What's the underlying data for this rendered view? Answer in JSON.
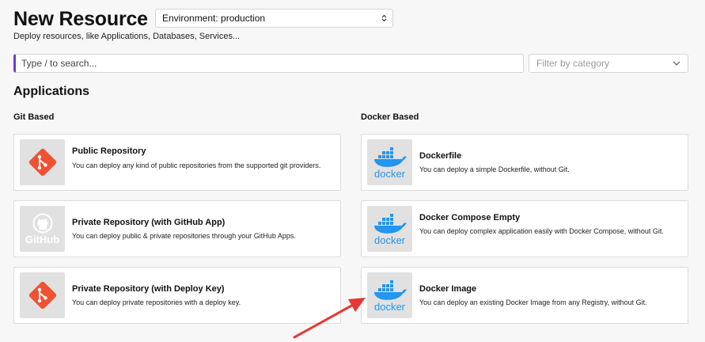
{
  "header": {
    "title": "New Resource",
    "environment_select": "Environment: production",
    "subtitle": "Deploy resources, like Applications, Databases, Services..."
  },
  "search": {
    "placeholder": "Type / to search...",
    "category_placeholder": "Filter by category"
  },
  "sections": {
    "applications": "Applications",
    "git_based": "Git Based",
    "docker_based": "Docker Based"
  },
  "git_cards": [
    {
      "title": "Public Repository",
      "description": "You can deploy any kind of public repositories from the supported git providers.",
      "icon": "git-icon"
    },
    {
      "title": "Private Repository (with GitHub App)",
      "description": "You can deploy public & private repositories through your GitHub Apps.",
      "icon": "github-icon"
    },
    {
      "title": "Private Repository (with Deploy Key)",
      "description": "You can deploy private repositories with a deploy key.",
      "icon": "git-icon"
    }
  ],
  "docker_cards": [
    {
      "title": "Dockerfile",
      "description": "You can deploy a simple Dockerfile, without Git.",
      "icon": "docker-icon"
    },
    {
      "title": "Docker Compose Empty",
      "description": "You can deploy complex application easily with Docker Compose, without Git.",
      "icon": "docker-icon"
    },
    {
      "title": "Docker Image",
      "description": "You can deploy an existing Docker Image from any Registry, without Git.",
      "icon": "docker-icon"
    }
  ],
  "icon_labels": {
    "github": "GitHub",
    "docker": "docker"
  },
  "colors": {
    "accent": "#6b3fd1",
    "git": "#f05133",
    "docker": "#2496ed",
    "annotation_arrow": "#e53935"
  }
}
